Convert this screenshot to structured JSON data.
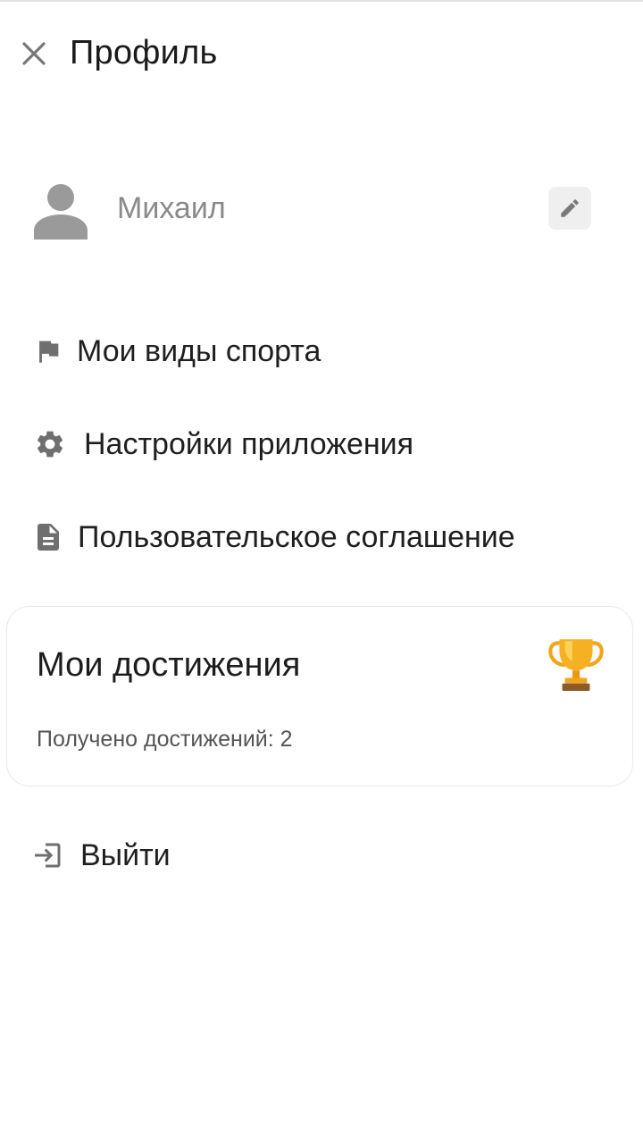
{
  "header": {
    "title": "Профиль",
    "close_icon": "close-icon"
  },
  "profile": {
    "avatar_icon": "person-icon",
    "name": "Михаил",
    "edit_icon": "pencil-icon"
  },
  "menu": {
    "items": [
      {
        "label": "Мои виды спорта",
        "icon": "flag-icon"
      },
      {
        "label": "Настройки приложения",
        "icon": "gear-icon"
      },
      {
        "label": "Пользовательское соглашение",
        "icon": "document-icon"
      }
    ]
  },
  "achievements": {
    "title": "Мои достижения",
    "count_text": "Получено достижений: 2",
    "icon": "trophy-icon"
  },
  "logout": {
    "label": "Выйти",
    "icon": "login-icon"
  },
  "colors": {
    "icon_gray": "#6f6f6f",
    "avatar_gray": "#9a9a9a",
    "trophy_gold": "#f2a51a"
  }
}
